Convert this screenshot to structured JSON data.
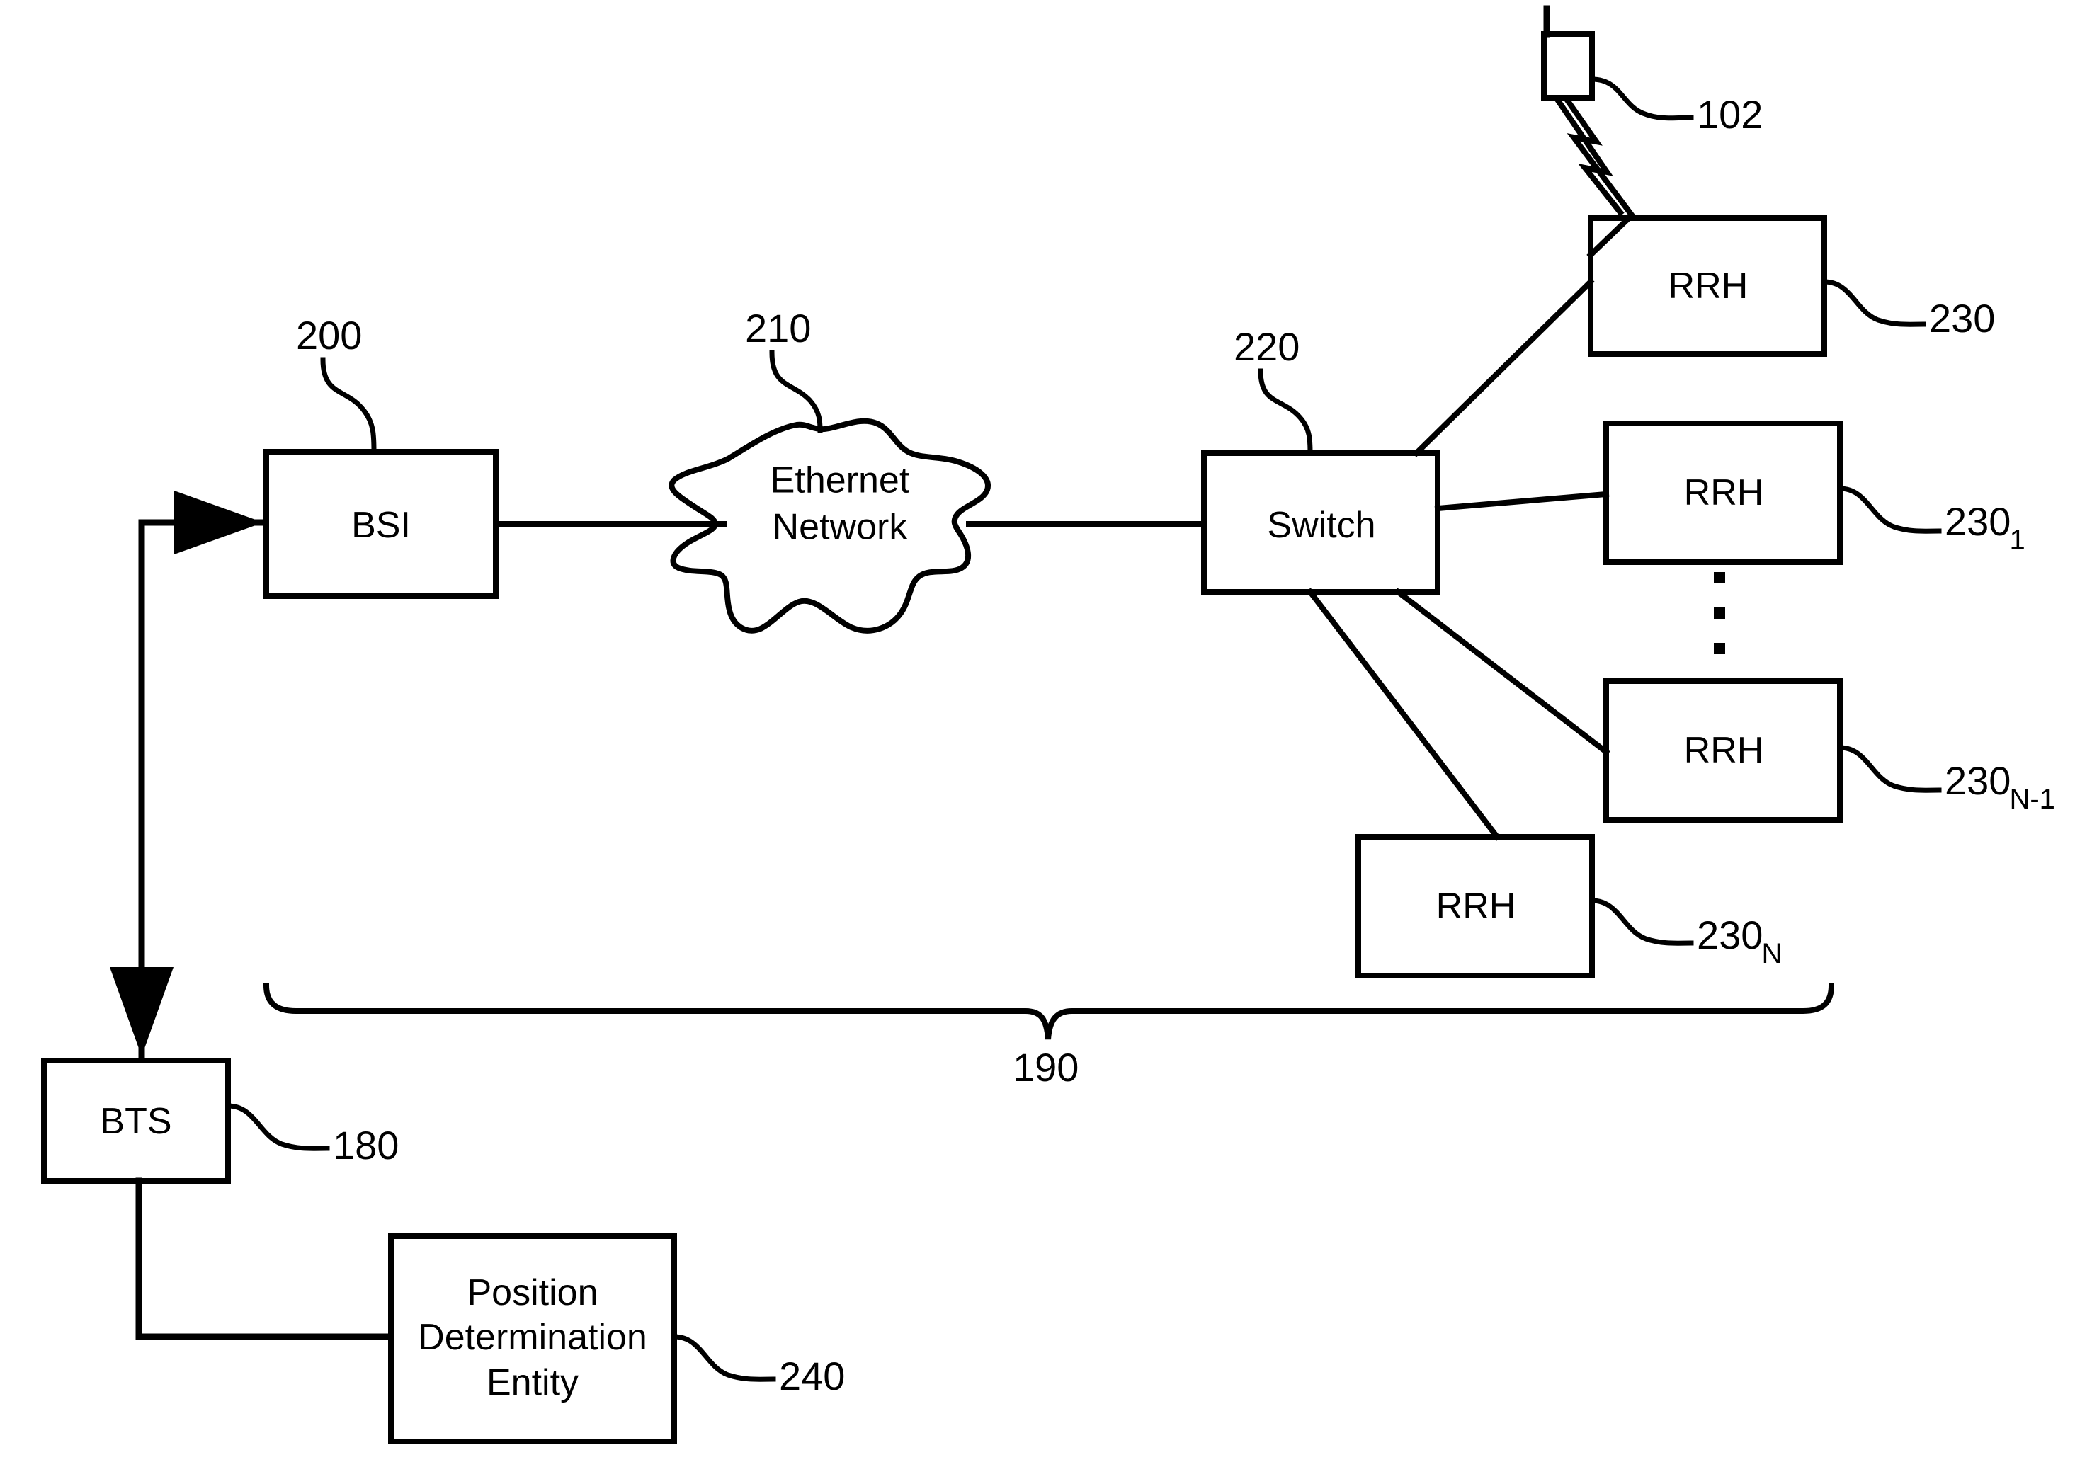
{
  "figure": {
    "kind": "patent-block-diagram",
    "background_color": "#ffffff",
    "line_color": "#000000"
  },
  "nodes": {
    "bsi": {
      "label": "BSI",
      "ref": "200"
    },
    "ethernet_network": {
      "label_line1": "Ethernet",
      "label_line2": "Network",
      "ref": "210"
    },
    "switch": {
      "label": "Switch",
      "ref": "220"
    },
    "rrh_0": {
      "label": "RRH",
      "ref": "230",
      "ref_sub": ""
    },
    "rrh_1": {
      "label": "RRH",
      "ref": "230",
      "ref_sub": "1"
    },
    "rrh_n_minus_1": {
      "label": "RRH",
      "ref": "230",
      "ref_sub": "N-1"
    },
    "rrh_n": {
      "label": "RRH",
      "ref": "230",
      "ref_sub": "N"
    },
    "mobile_station": {
      "label": "",
      "ref": "102"
    },
    "bts": {
      "label": "BTS",
      "ref": "180"
    },
    "position_determination_entity": {
      "label_line1": "Position",
      "label_line2": "Determination",
      "label_line3": "Entity",
      "ref": "240"
    },
    "group_brace": {
      "ref": "190"
    }
  }
}
